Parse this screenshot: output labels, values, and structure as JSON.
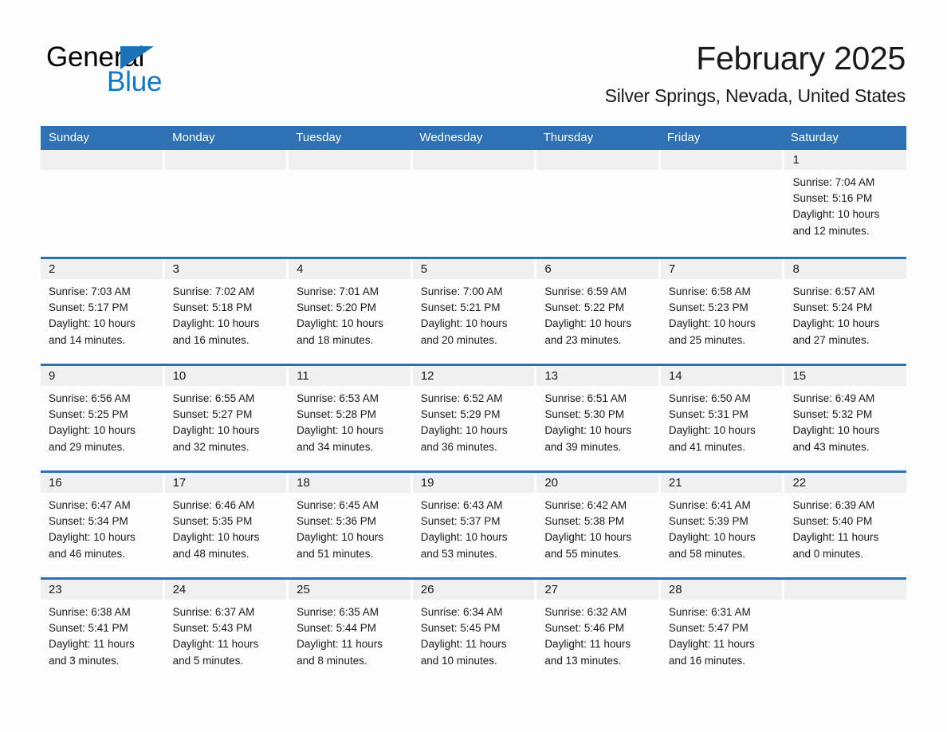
{
  "brand": {
    "name_part1": "General",
    "name_part2": "Blue",
    "logo_triangle": "blue-triangle-icon",
    "accent_color": "#2e71b4",
    "blue_text_color": "#1176c4"
  },
  "header": {
    "title": "February 2025",
    "subtitle": "Silver Springs, Nevada, United States"
  },
  "calendar": {
    "weekdays": [
      "Sunday",
      "Monday",
      "Tuesday",
      "Wednesday",
      "Thursday",
      "Friday",
      "Saturday"
    ],
    "header_bg": "#2e71b4",
    "header_text_color": "#ffffff",
    "date_band_bg": "#f0f0f0",
    "weeks": [
      {
        "days": [
          {
            "date": "",
            "lines": []
          },
          {
            "date": "",
            "lines": []
          },
          {
            "date": "",
            "lines": []
          },
          {
            "date": "",
            "lines": []
          },
          {
            "date": "",
            "lines": []
          },
          {
            "date": "",
            "lines": []
          },
          {
            "date": "1",
            "lines": [
              "Sunrise: 7:04 AM",
              "Sunset: 5:16 PM",
              "Daylight: 10 hours",
              "and 12 minutes."
            ]
          }
        ]
      },
      {
        "days": [
          {
            "date": "2",
            "lines": [
              "Sunrise: 7:03 AM",
              "Sunset: 5:17 PM",
              "Daylight: 10 hours",
              "and 14 minutes."
            ]
          },
          {
            "date": "3",
            "lines": [
              "Sunrise: 7:02 AM",
              "Sunset: 5:18 PM",
              "Daylight: 10 hours",
              "and 16 minutes."
            ]
          },
          {
            "date": "4",
            "lines": [
              "Sunrise: 7:01 AM",
              "Sunset: 5:20 PM",
              "Daylight: 10 hours",
              "and 18 minutes."
            ]
          },
          {
            "date": "5",
            "lines": [
              "Sunrise: 7:00 AM",
              "Sunset: 5:21 PM",
              "Daylight: 10 hours",
              "and 20 minutes."
            ]
          },
          {
            "date": "6",
            "lines": [
              "Sunrise: 6:59 AM",
              "Sunset: 5:22 PM",
              "Daylight: 10 hours",
              "and 23 minutes."
            ]
          },
          {
            "date": "7",
            "lines": [
              "Sunrise: 6:58 AM",
              "Sunset: 5:23 PM",
              "Daylight: 10 hours",
              "and 25 minutes."
            ]
          },
          {
            "date": "8",
            "lines": [
              "Sunrise: 6:57 AM",
              "Sunset: 5:24 PM",
              "Daylight: 10 hours",
              "and 27 minutes."
            ]
          }
        ]
      },
      {
        "days": [
          {
            "date": "9",
            "lines": [
              "Sunrise: 6:56 AM",
              "Sunset: 5:25 PM",
              "Daylight: 10 hours",
              "and 29 minutes."
            ]
          },
          {
            "date": "10",
            "lines": [
              "Sunrise: 6:55 AM",
              "Sunset: 5:27 PM",
              "Daylight: 10 hours",
              "and 32 minutes."
            ]
          },
          {
            "date": "11",
            "lines": [
              "Sunrise: 6:53 AM",
              "Sunset: 5:28 PM",
              "Daylight: 10 hours",
              "and 34 minutes."
            ]
          },
          {
            "date": "12",
            "lines": [
              "Sunrise: 6:52 AM",
              "Sunset: 5:29 PM",
              "Daylight: 10 hours",
              "and 36 minutes."
            ]
          },
          {
            "date": "13",
            "lines": [
              "Sunrise: 6:51 AM",
              "Sunset: 5:30 PM",
              "Daylight: 10 hours",
              "and 39 minutes."
            ]
          },
          {
            "date": "14",
            "lines": [
              "Sunrise: 6:50 AM",
              "Sunset: 5:31 PM",
              "Daylight: 10 hours",
              "and 41 minutes."
            ]
          },
          {
            "date": "15",
            "lines": [
              "Sunrise: 6:49 AM",
              "Sunset: 5:32 PM",
              "Daylight: 10 hours",
              "and 43 minutes."
            ]
          }
        ]
      },
      {
        "days": [
          {
            "date": "16",
            "lines": [
              "Sunrise: 6:47 AM",
              "Sunset: 5:34 PM",
              "Daylight: 10 hours",
              "and 46 minutes."
            ]
          },
          {
            "date": "17",
            "lines": [
              "Sunrise: 6:46 AM",
              "Sunset: 5:35 PM",
              "Daylight: 10 hours",
              "and 48 minutes."
            ]
          },
          {
            "date": "18",
            "lines": [
              "Sunrise: 6:45 AM",
              "Sunset: 5:36 PM",
              "Daylight: 10 hours",
              "and 51 minutes."
            ]
          },
          {
            "date": "19",
            "lines": [
              "Sunrise: 6:43 AM",
              "Sunset: 5:37 PM",
              "Daylight: 10 hours",
              "and 53 minutes."
            ]
          },
          {
            "date": "20",
            "lines": [
              "Sunrise: 6:42 AM",
              "Sunset: 5:38 PM",
              "Daylight: 10 hours",
              "and 55 minutes."
            ]
          },
          {
            "date": "21",
            "lines": [
              "Sunrise: 6:41 AM",
              "Sunset: 5:39 PM",
              "Daylight: 10 hours",
              "and 58 minutes."
            ]
          },
          {
            "date": "22",
            "lines": [
              "Sunrise: 6:39 AM",
              "Sunset: 5:40 PM",
              "Daylight: 11 hours",
              "and 0 minutes."
            ]
          }
        ]
      },
      {
        "days": [
          {
            "date": "23",
            "lines": [
              "Sunrise: 6:38 AM",
              "Sunset: 5:41 PM",
              "Daylight: 11 hours",
              "and 3 minutes."
            ]
          },
          {
            "date": "24",
            "lines": [
              "Sunrise: 6:37 AM",
              "Sunset: 5:43 PM",
              "Daylight: 11 hours",
              "and 5 minutes."
            ]
          },
          {
            "date": "25",
            "lines": [
              "Sunrise: 6:35 AM",
              "Sunset: 5:44 PM",
              "Daylight: 11 hours",
              "and 8 minutes."
            ]
          },
          {
            "date": "26",
            "lines": [
              "Sunrise: 6:34 AM",
              "Sunset: 5:45 PM",
              "Daylight: 11 hours",
              "and 10 minutes."
            ]
          },
          {
            "date": "27",
            "lines": [
              "Sunrise: 6:32 AM",
              "Sunset: 5:46 PM",
              "Daylight: 11 hours",
              "and 13 minutes."
            ]
          },
          {
            "date": "28",
            "lines": [
              "Sunrise: 6:31 AM",
              "Sunset: 5:47 PM",
              "Daylight: 11 hours",
              "and 16 minutes."
            ]
          },
          {
            "date": "",
            "lines": []
          }
        ]
      }
    ]
  }
}
